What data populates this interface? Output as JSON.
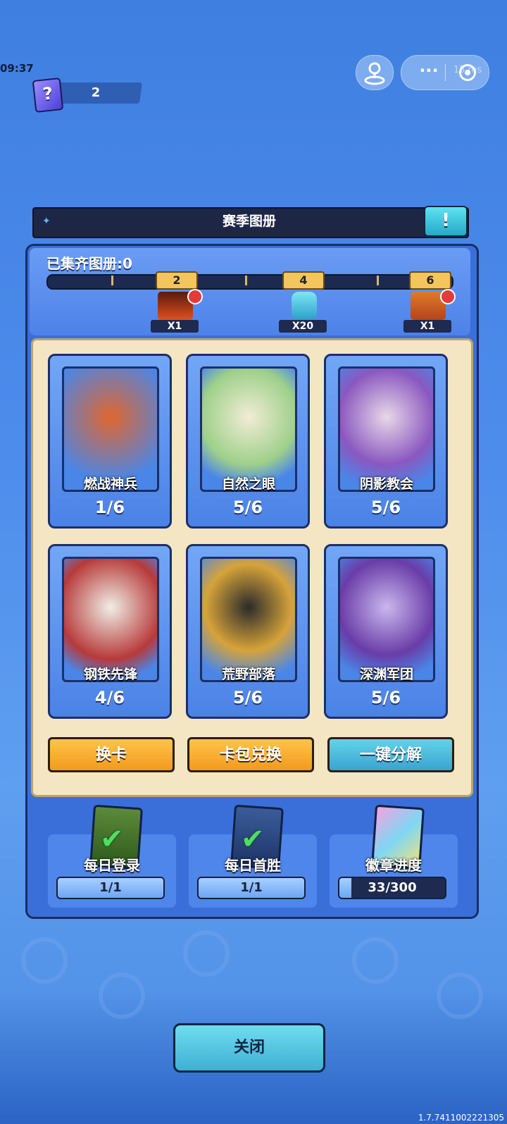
{
  "status": {
    "time": "09:37"
  },
  "card_counter": {
    "icon": "question-card-icon",
    "glyph": "?",
    "value": "2"
  },
  "capsule": {
    "dots": "···",
    "latency": "15 ms"
  },
  "title": "赛季图册",
  "info_glyph": "!",
  "collected_label": "已集齐图册:0",
  "milestones": [
    "2",
    "4",
    "6"
  ],
  "rewards": [
    {
      "qty": "X1",
      "icon": "fire-frame-icon"
    },
    {
      "qty": "X20",
      "icon": "battery-icon"
    },
    {
      "qty": "X1",
      "icon": "dragon-avatar-icon"
    }
  ],
  "albums": [
    {
      "name": "燃战神兵",
      "count": "1/6",
      "color": "#e0662e"
    },
    {
      "name": "自然之眼",
      "count": "5/6",
      "color": "#9fd08a"
    },
    {
      "name": "阴影教会",
      "count": "5/6",
      "color": "#8a58c0"
    },
    {
      "name": "钢铁先锋",
      "count": "4/6",
      "color": "#b73a3a"
    },
    {
      "name": "荒野部落",
      "count": "5/6",
      "color": "#d6a33a"
    },
    {
      "name": "深渊军团",
      "count": "5/6",
      "color": "#6a3ca8"
    }
  ],
  "buttons": {
    "swap": "换卡",
    "pack_exchange": "卡包兑换",
    "decompose": "一键分解",
    "close": "关闭"
  },
  "tasks": [
    {
      "label": "每日登录",
      "value": "1/1",
      "progress": 1.0
    },
    {
      "label": "每日首胜",
      "value": "1/1",
      "progress": 1.0
    },
    {
      "label": "徽章进度",
      "value": "33/300",
      "progress": 0.11
    }
  ],
  "version": "1.7.7411002221305"
}
